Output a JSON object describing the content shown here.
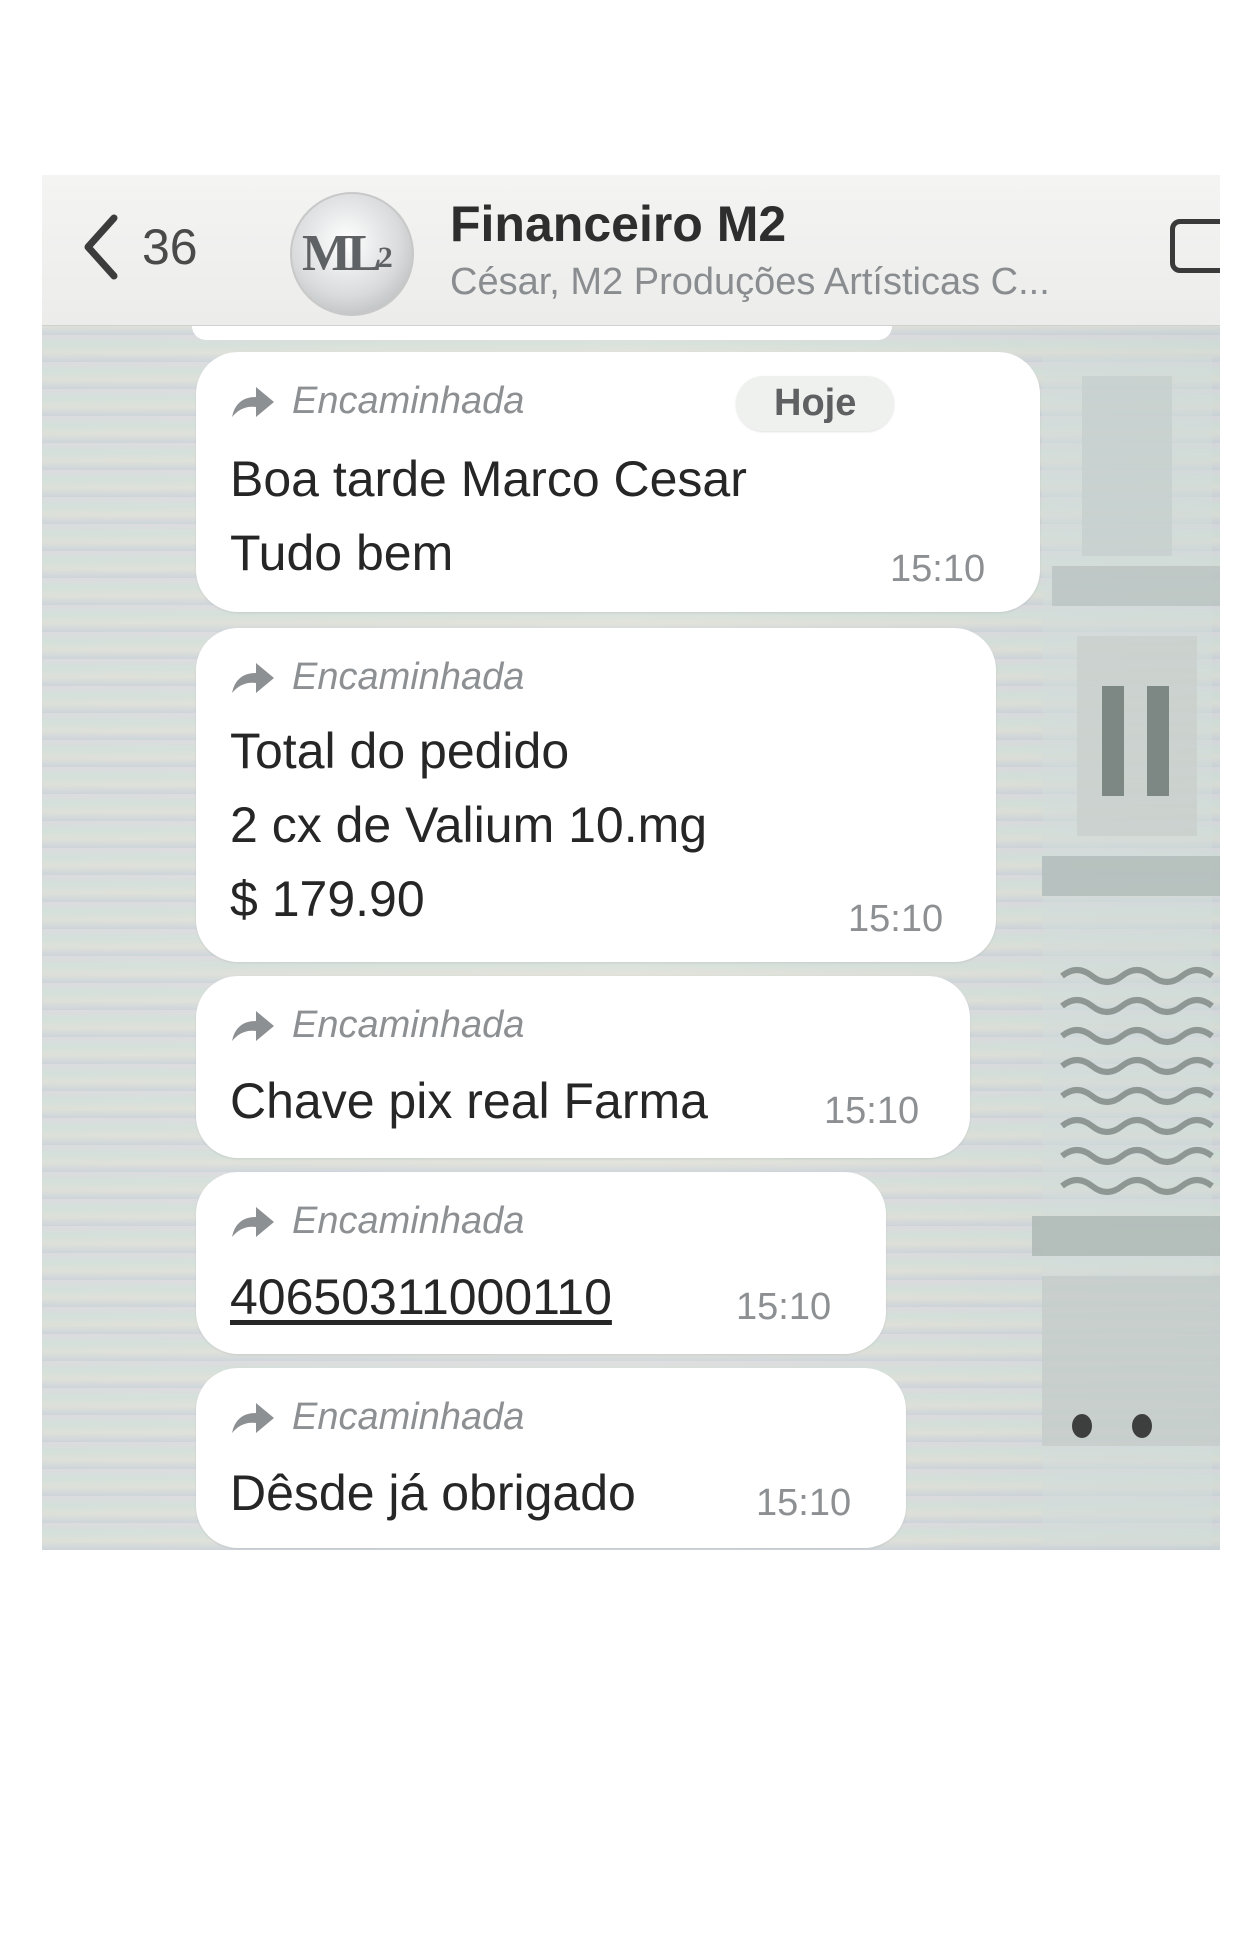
{
  "header": {
    "back_count": "36",
    "avatar_logo": "ML",
    "avatar_logo_sub": "2",
    "title": "Financeiro M2",
    "subtitle": "César, M2 Produções Artísticas C..."
  },
  "day_badge": "Hoje",
  "messages": [
    {
      "forwarded_label": "Encaminhada",
      "lines": [
        "Boa tarde Marco Cesar",
        "Tudo bem"
      ],
      "time": "15:10"
    },
    {
      "forwarded_label": "Encaminhada",
      "lines": [
        "Total do pedido",
        "2 cx de Valium  10.mg",
        "$ 179.90"
      ],
      "time": "15:10"
    },
    {
      "forwarded_label": "Encaminhada",
      "lines": [
        "Chave pix real Farma"
      ],
      "time": "15:10"
    },
    {
      "forwarded_label": "Encaminhada",
      "lines": [
        "40650311000110"
      ],
      "time": "15:10"
    },
    {
      "forwarded_label": "Encaminhada",
      "lines": [
        "Dêsde já obrigado"
      ],
      "time": "15:10"
    }
  ],
  "icons": {
    "back": "chevron-left-icon",
    "forward": "forward-arrow-icon",
    "video": "video-call-icon"
  },
  "colors": {
    "bubble": "#ffffff",
    "text": "#262626",
    "meta": "#8d9093"
  }
}
